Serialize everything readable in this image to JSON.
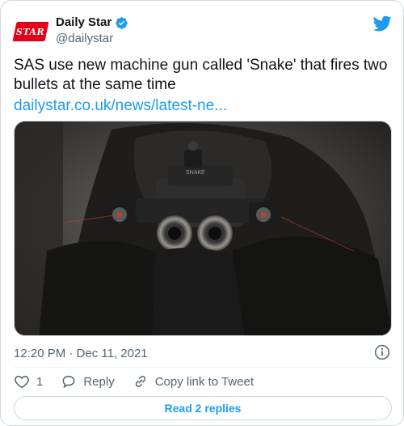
{
  "account": {
    "display_name": "Daily Star",
    "handle": "@dailystar",
    "logo_text": "STAR",
    "verified_color": "#1d9bf0"
  },
  "tweet": {
    "text": "SAS use new machine gun called 'Snake' that fires two bullets at the same time",
    "link_text": "dailystar.co.uk/news/latest-ne...",
    "timestamp": "12:20 PM · Dec 11, 2021"
  },
  "actions": {
    "like_count": "1",
    "reply_label": "Reply",
    "copy_label": "Copy link to Tweet"
  },
  "footer": {
    "read_replies_label": "Read 2 replies"
  },
  "colors": {
    "brand_red": "#e2001a",
    "link_blue": "#1d9bf0",
    "muted_text": "#536471",
    "border": "#cfd9de"
  },
  "icons": [
    "daily-star-logo",
    "verified-badge-icon",
    "twitter-bird-icon",
    "info-icon",
    "heart-icon",
    "reply-icon",
    "link-icon"
  ]
}
